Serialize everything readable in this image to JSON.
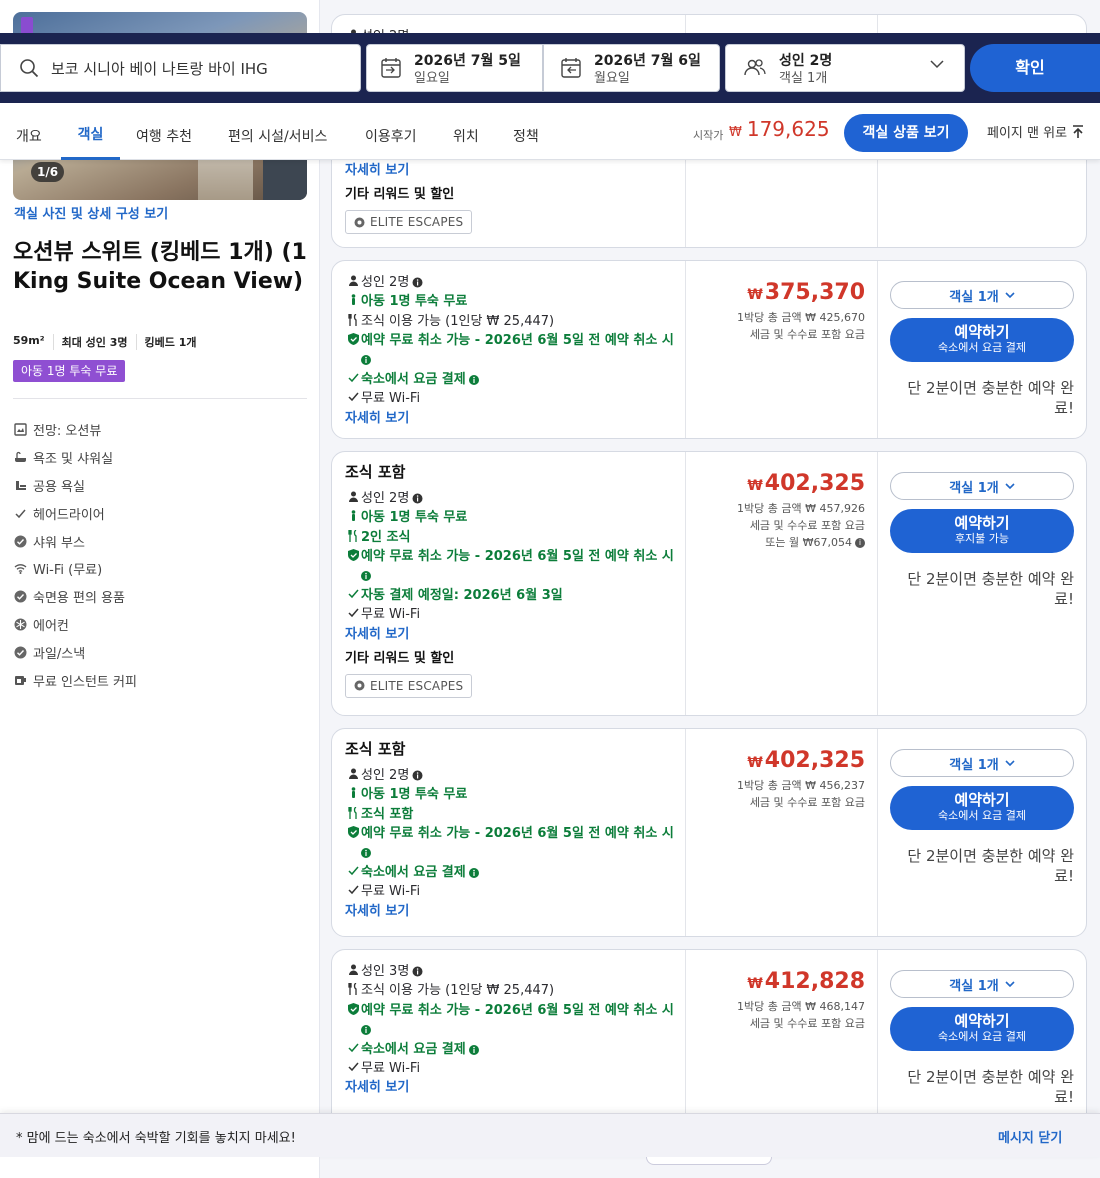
{
  "search": {
    "query": "보코 시니아 베이 나트랑 바이 IHG",
    "checkin_date": "2026년 7월 5일",
    "checkin_day": "일요일",
    "checkout_date": "2026년 7월 6일",
    "checkout_day": "월요일",
    "guests": "성인 2명",
    "rooms": "객실 1개",
    "confirm_label": "확인"
  },
  "tabs": [
    "개요",
    "객실",
    "여행 추천",
    "편의 시설/서비스",
    "이용후기",
    "위치",
    "정책"
  ],
  "tabs_active": "객실",
  "header_price": {
    "prefix": "시작가",
    "currency": "₩",
    "amount": "179,625",
    "view_button": "객실 상품 보기",
    "back_to_top": "페이지 맨 위로"
  },
  "room": {
    "photo_counter": "1/6",
    "photo_link": "객실 사진 및 상세 구성 보기",
    "title": "오션뷰 스위트 (킹베드 1개) (1 King Suite Ocean View)",
    "meta": [
      "59m²",
      "최대 성인 3명",
      "킹베드 1개"
    ],
    "badge": "아동 1명 투숙 무료",
    "amenities": [
      {
        "icon": "view-icon",
        "label": "전망: 오션뷰"
      },
      {
        "icon": "bathtub-icon",
        "label": "욕조 및 샤워실"
      },
      {
        "icon": "shared-bath-icon",
        "label": "공용 욕실"
      },
      {
        "icon": "check-icon",
        "label": "헤어드라이어"
      },
      {
        "icon": "check-circle-icon",
        "label": "샤워 부스"
      },
      {
        "icon": "wifi-icon",
        "label": "Wi-Fi (무료)"
      },
      {
        "icon": "check-circle-icon",
        "label": "숙면용 편의 용품"
      },
      {
        "icon": "snowflake-icon",
        "label": "에어컨"
      },
      {
        "icon": "check-circle-icon",
        "label": "과일/스낵"
      },
      {
        "icon": "coffee-icon",
        "label": "무료 인스턴트 커피"
      }
    ]
  },
  "card0": {
    "top_text": "성인 2명",
    "link": "자세히 보기",
    "section": "기타 리워드 및 할인",
    "elite": "ELITE ESCAPES"
  },
  "offers": [
    {
      "adults": "성인 2명",
      "child": "아동 1명 투숙 무료",
      "breakfast": "조식 이용 가능 (1인당 ₩ 25,447)",
      "cancel": "예약 무료 취소 가능 - 2026년 6월 5일 전 예약 취소 시",
      "payment": "숙소에서 요금 결제",
      "wifi": "무료 Wi-Fi",
      "link": "자세히 보기",
      "currency": "₩",
      "price": "375,370",
      "total": "1박당 총 금액 ₩ 425,670",
      "tax": "세금 및 수수료 포함 요금",
      "qty": "객실 1개",
      "book": "예약하기",
      "book_sub": "숙소에서 요금 결제",
      "urgency": "단 2분이면 충분한 예약 완료!"
    },
    {
      "headline": "조식 포함",
      "adults": "성인 2명",
      "child": "아동 1명 투숙 무료",
      "breakfast": "2인 조식",
      "cancel": "예약 무료 취소 가능 - 2026년 6월 5일 전 예약 취소 시",
      "payment": "자동 결제 예정일: 2026년 6월 3일",
      "wifi": "무료 Wi-Fi",
      "link": "자세히 보기",
      "section": "기타 리워드 및 할인",
      "elite": "ELITE ESCAPES",
      "currency": "₩",
      "price": "402,325",
      "total": "1박당 총 금액 ₩ 457,926",
      "tax": "세금 및 수수료 포함 요금",
      "monthly": "또는 월 ₩67,054",
      "qty": "객실 1개",
      "book": "예약하기",
      "book_sub": "후지불 가능",
      "urgency": "단 2분이면 충분한 예약 완료!"
    },
    {
      "headline": "조식 포함",
      "adults": "성인 2명",
      "child": "아동 1명 투숙 무료",
      "breakfast": "조식 포함",
      "cancel": "예약 무료 취소 가능 - 2026년 6월 5일 전 예약 취소 시",
      "payment": "숙소에서 요금 결제",
      "wifi": "무료 Wi-Fi",
      "link": "자세히 보기",
      "currency": "₩",
      "price": "402,325",
      "total": "1박당 총 금액 ₩ 456,237",
      "tax": "세금 및 수수료 포함 요금",
      "qty": "객실 1개",
      "book": "예약하기",
      "book_sub": "숙소에서 요금 결제",
      "urgency": "단 2분이면 충분한 예약 완료!"
    },
    {
      "adults": "성인 3명",
      "breakfast": "조식 이용 가능 (1인당 ₩ 25,447)",
      "cancel": "예약 무료 취소 가능 - 2026년 6월 5일 전 예약 취소 시",
      "payment": "숙소에서 요금 결제",
      "wifi": "무료 Wi-Fi",
      "link": "자세히 보기",
      "currency": "₩",
      "price": "412,828",
      "total": "1박당 총 금액 ₩ 468,147",
      "tax": "세금 및 수수료 포함 요금",
      "qty": "객실 1개",
      "book": "예약하기",
      "book_sub": "숙소에서 요금 결제",
      "urgency": "단 2분이면 충분한 예약 완료!"
    }
  ],
  "bottom": {
    "message": "* 맘에 드는 숙소에서 숙박할 기회를 놓치지 마세요!",
    "close": "메시지 닫기"
  },
  "colors": {
    "accent": "#1f63d3",
    "price": "#d0372a",
    "green": "#0c7d3a",
    "nav": "#1b2450",
    "badge": "#8f4fd2"
  }
}
